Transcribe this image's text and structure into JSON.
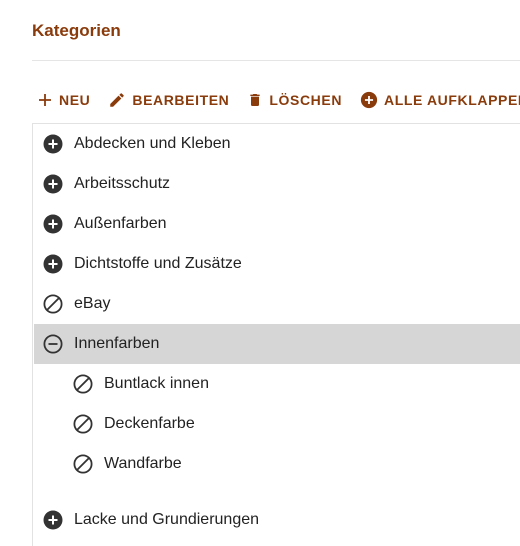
{
  "page": {
    "title": "Kategorien"
  },
  "toolbar": {
    "new_label": "NEU",
    "edit_label": "BEARBEITEN",
    "delete_label": "LÖSCHEN",
    "expand_all_label": "ALLE AUFKLAPPEN"
  },
  "colors": {
    "accent": "#8a3b0c",
    "icon": "#333333",
    "selected_row": "#d6d6d6",
    "text": "#222222"
  },
  "tree": {
    "items": [
      {
        "label": "Abdecken und Kleben",
        "icon": "plus-circle-icon"
      },
      {
        "label": "Arbeitsschutz",
        "icon": "plus-circle-icon"
      },
      {
        "label": "Außenfarben",
        "icon": "plus-circle-icon"
      },
      {
        "label": "Dichtstoffe und Zusätze",
        "icon": "plus-circle-icon"
      },
      {
        "label": "eBay",
        "icon": "block-icon"
      },
      {
        "label": "Innenfarben",
        "icon": "minus-circle-icon",
        "selected": true,
        "expanded": true
      },
      {
        "label": "Buntlack innen",
        "icon": "block-icon",
        "parent": "Innenfarben"
      },
      {
        "label": "Deckenfarbe",
        "icon": "block-icon",
        "parent": "Innenfarben"
      },
      {
        "label": "Wandfarbe",
        "icon": "block-icon",
        "parent": "Innenfarben"
      },
      {
        "label": "Lacke und Grundierungen",
        "icon": "plus-circle-icon"
      }
    ]
  }
}
